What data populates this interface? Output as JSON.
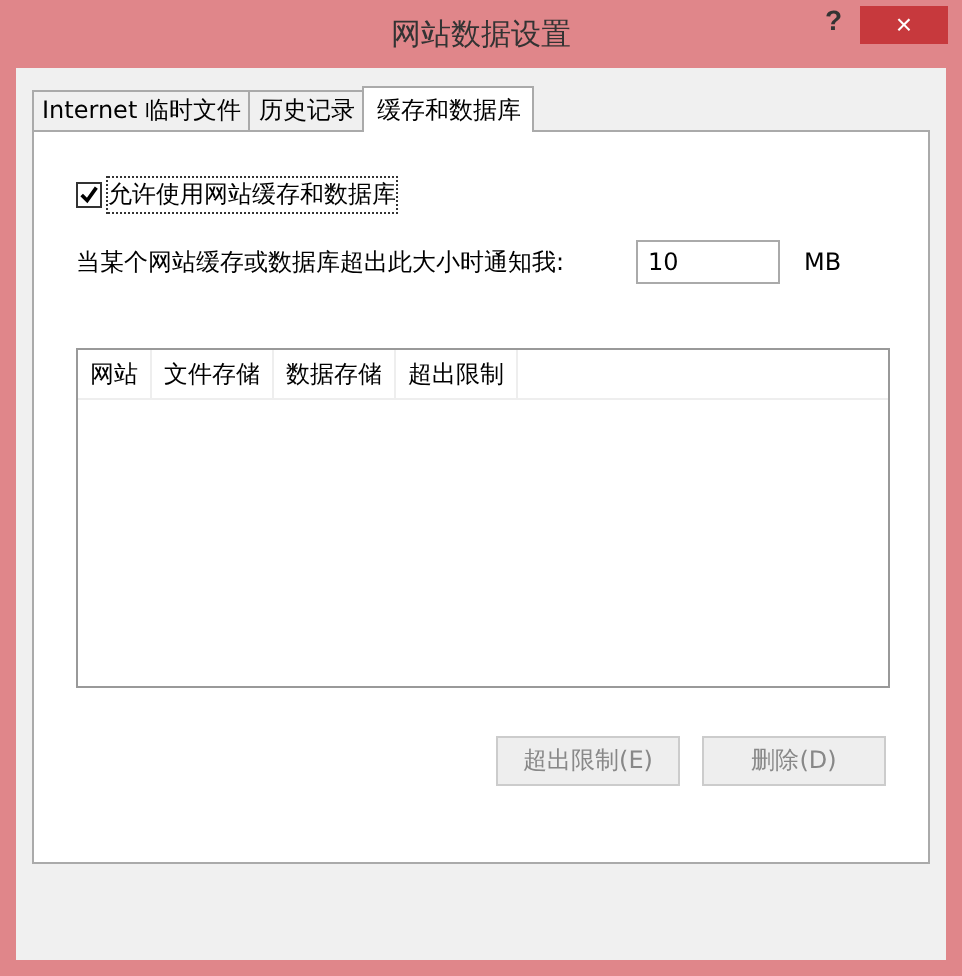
{
  "window": {
    "title": "网站数据设置",
    "help": "?",
    "close": "×"
  },
  "tabs": [
    {
      "label": "Internet 临时文件",
      "selected": false
    },
    {
      "label": "历史记录",
      "selected": false
    },
    {
      "label": "缓存和数据库",
      "selected": true
    }
  ],
  "allow_cache": {
    "label": "允许使用网站缓存和数据库",
    "checked": true
  },
  "notify": {
    "label": "当某个网站缓存或数据库超出此大小时通知我:",
    "value": "10",
    "unit": "MB"
  },
  "table": {
    "columns": [
      "网站",
      "文件存储",
      "数据存储",
      "超出限制"
    ]
  },
  "buttons": [
    {
      "label": "超出限制(E)",
      "disabled": true
    },
    {
      "label": "删除(D)",
      "disabled": true
    }
  ]
}
